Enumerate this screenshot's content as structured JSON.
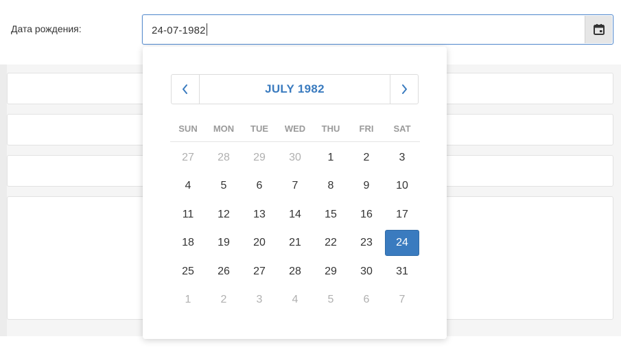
{
  "form": {
    "birth_date_label": "Дата рождения:",
    "birth_date_value": "24-07-1982"
  },
  "icons": {
    "calendar": "calendar-icon",
    "prev": "chevron-left-icon",
    "next": "chevron-right-icon"
  },
  "colors": {
    "accent": "#3a7bbf",
    "muted_day": "#b0b0b0",
    "weekday_header": "#9a9a9a",
    "input_border": "#5b8fcf"
  },
  "calendar": {
    "month_title": "JULY 1982",
    "weekdays": [
      "SUN",
      "MON",
      "TUE",
      "WED",
      "THU",
      "FRI",
      "SAT"
    ],
    "selected_day": "24",
    "weeks": [
      [
        {
          "d": "27",
          "muted": true
        },
        {
          "d": "28",
          "muted": true
        },
        {
          "d": "29",
          "muted": true
        },
        {
          "d": "30",
          "muted": true
        },
        {
          "d": "1",
          "muted": false
        },
        {
          "d": "2",
          "muted": false
        },
        {
          "d": "3",
          "muted": false
        }
      ],
      [
        {
          "d": "4",
          "muted": false
        },
        {
          "d": "5",
          "muted": false
        },
        {
          "d": "6",
          "muted": false
        },
        {
          "d": "7",
          "muted": false
        },
        {
          "d": "8",
          "muted": false
        },
        {
          "d": "9",
          "muted": false
        },
        {
          "d": "10",
          "muted": false
        }
      ],
      [
        {
          "d": "11",
          "muted": false
        },
        {
          "d": "12",
          "muted": false
        },
        {
          "d": "13",
          "muted": false
        },
        {
          "d": "14",
          "muted": false
        },
        {
          "d": "15",
          "muted": false
        },
        {
          "d": "16",
          "muted": false
        },
        {
          "d": "17",
          "muted": false
        }
      ],
      [
        {
          "d": "18",
          "muted": false
        },
        {
          "d": "19",
          "muted": false
        },
        {
          "d": "20",
          "muted": false
        },
        {
          "d": "21",
          "muted": false
        },
        {
          "d": "22",
          "muted": false
        },
        {
          "d": "23",
          "muted": false
        },
        {
          "d": "24",
          "muted": false,
          "selected": true
        }
      ],
      [
        {
          "d": "25",
          "muted": false
        },
        {
          "d": "26",
          "muted": false
        },
        {
          "d": "27",
          "muted": false
        },
        {
          "d": "28",
          "muted": false
        },
        {
          "d": "29",
          "muted": false
        },
        {
          "d": "30",
          "muted": false
        },
        {
          "d": "31",
          "muted": false
        }
      ],
      [
        {
          "d": "1",
          "muted": true
        },
        {
          "d": "2",
          "muted": true
        },
        {
          "d": "3",
          "muted": true
        },
        {
          "d": "4",
          "muted": true
        },
        {
          "d": "5",
          "muted": true
        },
        {
          "d": "6",
          "muted": true
        },
        {
          "d": "7",
          "muted": true
        }
      ]
    ]
  }
}
